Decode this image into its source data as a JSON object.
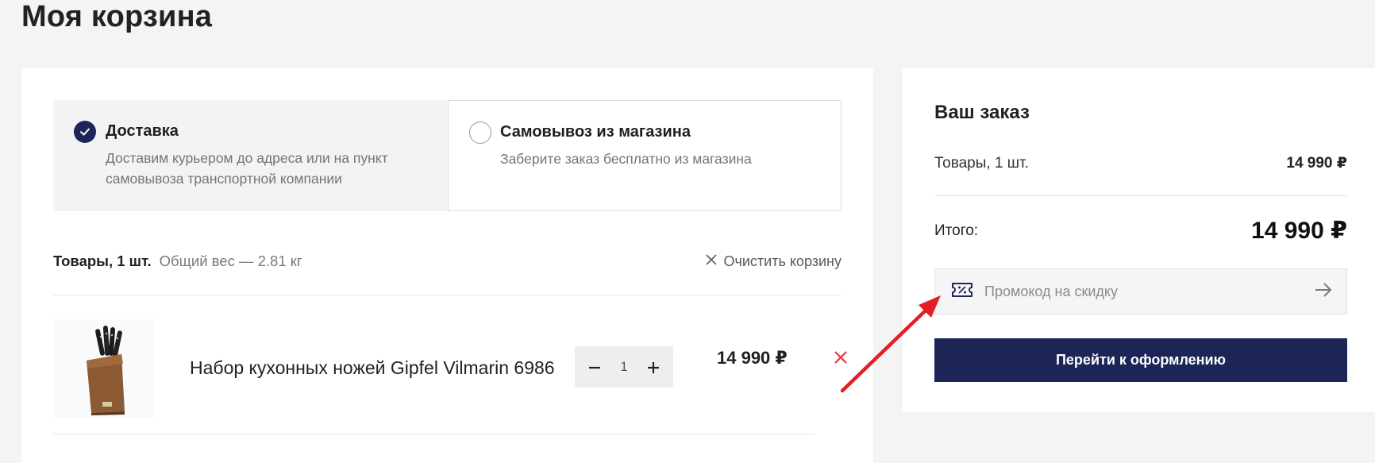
{
  "page": {
    "title": "Моя корзина"
  },
  "delivery": {
    "options": [
      {
        "title": "Доставка",
        "description": "Доставим курьером до адреса или на пункт самовывоза транспортной компании",
        "selected": true
      },
      {
        "title": "Самовывоз из магазина",
        "description": "Заберите заказ бесплатно из магазина",
        "selected": false
      }
    ]
  },
  "cart": {
    "items_count": "Товары, 1 шт.",
    "total_weight": "Общий вес — 2.81 кг",
    "clear_label": "Очистить корзину",
    "items": [
      {
        "name": "Набор кухонных ножей Gipfel Vilmarin 6986",
        "quantity": "1",
        "price": "14 990 ₽"
      }
    ]
  },
  "order": {
    "title": "Ваш заказ",
    "goods_label": "Товары, 1 шт.",
    "goods_value": "14 990 ₽",
    "total_label": "Итого:",
    "total_value": "14 990 ₽",
    "promo_placeholder": "Промокод на скидку",
    "checkout_label": "Перейти к оформлению"
  },
  "colors": {
    "accent": "#1d2556",
    "remove": "#e0383e",
    "annotation_arrow": "#e31e24"
  }
}
